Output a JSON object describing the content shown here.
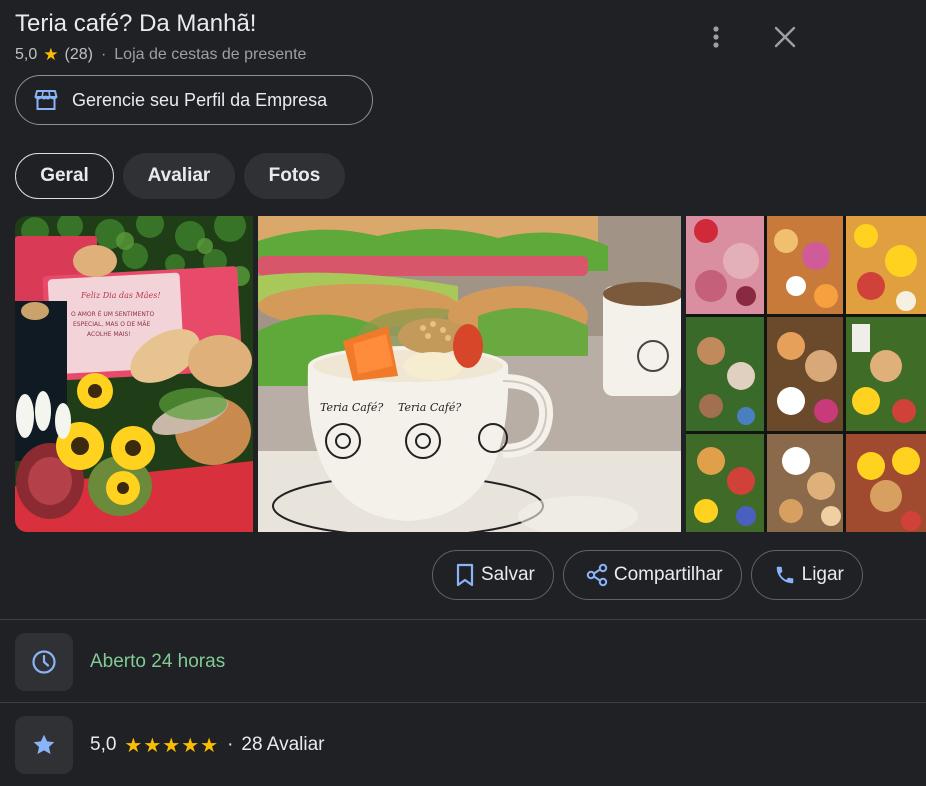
{
  "place": {
    "name": "Teria café? Da Manhã!",
    "rating": "5,0",
    "review_count": "(28)",
    "separator": "·",
    "category": "Loja de cestas de presente"
  },
  "header_icons": {
    "more": "more-vert-icon",
    "close": "close-icon"
  },
  "manage_profile": {
    "label": "Gerencie seu Perfil da Empresa",
    "icon": "storefront-icon"
  },
  "tabs": [
    {
      "label": "Geral",
      "active": true
    },
    {
      "label": "Avaliar",
      "active": false
    },
    {
      "label": "Fotos",
      "active": false
    }
  ],
  "photo_card_text": {
    "heading": "Feliz Dia das Mães!",
    "line1": "O AMOR É UM SENTIMENTO",
    "line2": "ESPECIAL, MAS O DE MÃE",
    "line3": "ACOLHE MAIS!",
    "cup_text": "Teria Café?"
  },
  "actions": [
    {
      "label": "Salvar",
      "icon": "bookmark-icon"
    },
    {
      "label": "Compartilhar",
      "icon": "share-icon"
    },
    {
      "label": "Ligar",
      "icon": "phone-icon"
    }
  ],
  "hours": {
    "text": "Aberto 24 horas",
    "icon": "clock-icon"
  },
  "reviews": {
    "rating": "5,0",
    "stars": "★★★★★",
    "separator": "·",
    "text": "28 Avaliar",
    "icon": "star-icon"
  },
  "colors": {
    "background": "#202124",
    "star": "#fbbc04",
    "open_green": "#81c995",
    "accent_blue": "#8ab4f8"
  }
}
